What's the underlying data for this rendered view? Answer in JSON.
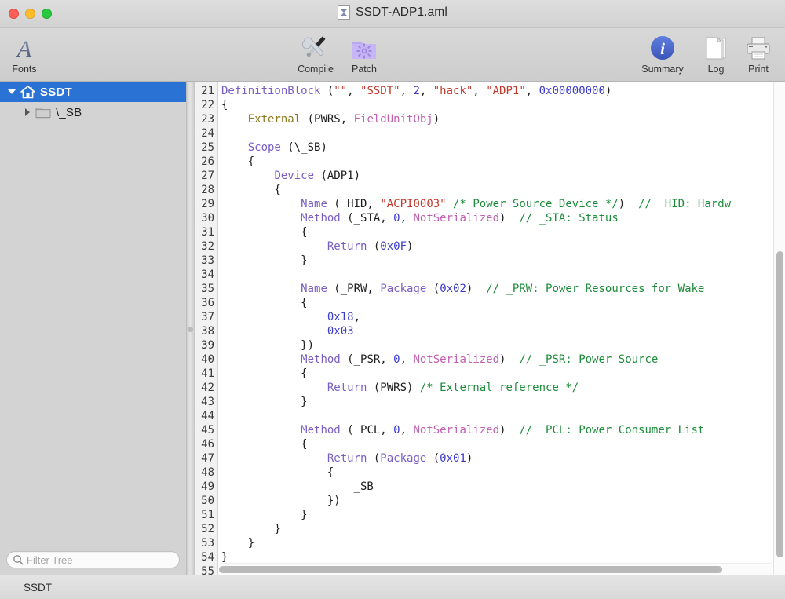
{
  "window": {
    "title": "SSDT-ADP1.aml",
    "doc_icon": "aml-document-icon",
    "traffic_lights": [
      "close-button",
      "minimize-button",
      "zoom-button"
    ]
  },
  "toolbar": {
    "items": [
      {
        "id": "fonts",
        "label": "Fonts",
        "icon": "fonts-icon"
      },
      {
        "id": "compile",
        "label": "Compile",
        "icon": "compile-tools-icon"
      },
      {
        "id": "patch",
        "label": "Patch",
        "icon": "patch-folder-icon"
      },
      {
        "id": "summary",
        "label": "Summary",
        "icon": "info-circle-icon"
      },
      {
        "id": "log",
        "label": "Log",
        "icon": "pages-stack-icon"
      },
      {
        "id": "print",
        "label": "Print",
        "icon": "printer-icon"
      }
    ]
  },
  "sidebar": {
    "tree": [
      {
        "label": "SSDT",
        "icon": "home-icon",
        "disclosure": "down",
        "selected": true,
        "depth": 0
      },
      {
        "label": "\\_SB",
        "icon": "folder-icon",
        "disclosure": "right",
        "selected": false,
        "depth": 1
      }
    ],
    "filter": {
      "placeholder": "Filter Tree",
      "value": "",
      "icon": "search-icon"
    }
  },
  "editor": {
    "first_line": 21,
    "last_line": 55,
    "lines": [
      {
        "n": 21,
        "tokens": [
          {
            "t": "kw",
            "v": "DefinitionBlock"
          },
          {
            "t": "pln",
            "v": " ("
          },
          {
            "t": "str",
            "v": "\"\""
          },
          {
            "t": "pln",
            "v": ", "
          },
          {
            "t": "str",
            "v": "\"SSDT\""
          },
          {
            "t": "pln",
            "v": ", "
          },
          {
            "t": "num",
            "v": "2"
          },
          {
            "t": "pln",
            "v": ", "
          },
          {
            "t": "str",
            "v": "\"hack\""
          },
          {
            "t": "pln",
            "v": ", "
          },
          {
            "t": "str",
            "v": "\"ADP1\""
          },
          {
            "t": "pln",
            "v": ", "
          },
          {
            "t": "num",
            "v": "0x00000000"
          },
          {
            "t": "pln",
            "v": ")"
          }
        ]
      },
      {
        "n": 22,
        "tokens": [
          {
            "t": "pln",
            "v": "{"
          }
        ]
      },
      {
        "n": 23,
        "tokens": [
          {
            "t": "pln",
            "v": "    "
          },
          {
            "t": "ext",
            "v": "External"
          },
          {
            "t": "pln",
            "v": " (PWRS, "
          },
          {
            "t": "typ",
            "v": "FieldUnitObj"
          },
          {
            "t": "pln",
            "v": ")"
          }
        ]
      },
      {
        "n": 24,
        "tokens": [
          {
            "t": "pln",
            "v": ""
          }
        ]
      },
      {
        "n": 25,
        "tokens": [
          {
            "t": "pln",
            "v": "    "
          },
          {
            "t": "kw",
            "v": "Scope"
          },
          {
            "t": "pln",
            "v": " (\\_SB)"
          }
        ]
      },
      {
        "n": 26,
        "tokens": [
          {
            "t": "pln",
            "v": "    {"
          }
        ]
      },
      {
        "n": 27,
        "tokens": [
          {
            "t": "pln",
            "v": "        "
          },
          {
            "t": "kw",
            "v": "Device"
          },
          {
            "t": "pln",
            "v": " (ADP1)"
          }
        ]
      },
      {
        "n": 28,
        "tokens": [
          {
            "t": "pln",
            "v": "        {"
          }
        ]
      },
      {
        "n": 29,
        "tokens": [
          {
            "t": "pln",
            "v": "            "
          },
          {
            "t": "kw",
            "v": "Name"
          },
          {
            "t": "pln",
            "v": " (_HID, "
          },
          {
            "t": "str",
            "v": "\"ACPI0003\""
          },
          {
            "t": "pln",
            "v": " "
          },
          {
            "t": "cmt",
            "v": "/* Power Source Device */"
          },
          {
            "t": "pln",
            "v": ")  "
          },
          {
            "t": "cmt",
            "v": "// _HID: Hardw"
          }
        ]
      },
      {
        "n": 30,
        "tokens": [
          {
            "t": "pln",
            "v": "            "
          },
          {
            "t": "kw",
            "v": "Method"
          },
          {
            "t": "pln",
            "v": " (_STA, "
          },
          {
            "t": "num",
            "v": "0"
          },
          {
            "t": "pln",
            "v": ", "
          },
          {
            "t": "typ",
            "v": "NotSerialized"
          },
          {
            "t": "pln",
            "v": ")  "
          },
          {
            "t": "cmt",
            "v": "// _STA: Status"
          }
        ]
      },
      {
        "n": 31,
        "tokens": [
          {
            "t": "pln",
            "v": "            {"
          }
        ]
      },
      {
        "n": 32,
        "tokens": [
          {
            "t": "pln",
            "v": "                "
          },
          {
            "t": "kw",
            "v": "Return"
          },
          {
            "t": "pln",
            "v": " ("
          },
          {
            "t": "num",
            "v": "0x0F"
          },
          {
            "t": "pln",
            "v": ")"
          }
        ]
      },
      {
        "n": 33,
        "tokens": [
          {
            "t": "pln",
            "v": "            }"
          }
        ]
      },
      {
        "n": 34,
        "tokens": [
          {
            "t": "pln",
            "v": ""
          }
        ]
      },
      {
        "n": 35,
        "tokens": [
          {
            "t": "pln",
            "v": "            "
          },
          {
            "t": "kw",
            "v": "Name"
          },
          {
            "t": "pln",
            "v": " (_PRW, "
          },
          {
            "t": "kw",
            "v": "Package"
          },
          {
            "t": "pln",
            "v": " ("
          },
          {
            "t": "num",
            "v": "0x02"
          },
          {
            "t": "pln",
            "v": ")  "
          },
          {
            "t": "cmt",
            "v": "// _PRW: Power Resources for Wake"
          }
        ]
      },
      {
        "n": 36,
        "tokens": [
          {
            "t": "pln",
            "v": "            {"
          }
        ]
      },
      {
        "n": 37,
        "tokens": [
          {
            "t": "pln",
            "v": "                "
          },
          {
            "t": "num",
            "v": "0x18"
          },
          {
            "t": "pln",
            "v": ","
          }
        ]
      },
      {
        "n": 38,
        "tokens": [
          {
            "t": "pln",
            "v": "                "
          },
          {
            "t": "num",
            "v": "0x03"
          }
        ]
      },
      {
        "n": 39,
        "tokens": [
          {
            "t": "pln",
            "v": "            })"
          }
        ]
      },
      {
        "n": 40,
        "tokens": [
          {
            "t": "pln",
            "v": "            "
          },
          {
            "t": "kw",
            "v": "Method"
          },
          {
            "t": "pln",
            "v": " (_PSR, "
          },
          {
            "t": "num",
            "v": "0"
          },
          {
            "t": "pln",
            "v": ", "
          },
          {
            "t": "typ",
            "v": "NotSerialized"
          },
          {
            "t": "pln",
            "v": ")  "
          },
          {
            "t": "cmt",
            "v": "// _PSR: Power Source"
          }
        ]
      },
      {
        "n": 41,
        "tokens": [
          {
            "t": "pln",
            "v": "            {"
          }
        ]
      },
      {
        "n": 42,
        "tokens": [
          {
            "t": "pln",
            "v": "                "
          },
          {
            "t": "kw",
            "v": "Return"
          },
          {
            "t": "pln",
            "v": " (PWRS) "
          },
          {
            "t": "cmt",
            "v": "/* External reference */"
          }
        ]
      },
      {
        "n": 43,
        "tokens": [
          {
            "t": "pln",
            "v": "            }"
          }
        ]
      },
      {
        "n": 44,
        "tokens": [
          {
            "t": "pln",
            "v": ""
          }
        ]
      },
      {
        "n": 45,
        "tokens": [
          {
            "t": "pln",
            "v": "            "
          },
          {
            "t": "kw",
            "v": "Method"
          },
          {
            "t": "pln",
            "v": " (_PCL, "
          },
          {
            "t": "num",
            "v": "0"
          },
          {
            "t": "pln",
            "v": ", "
          },
          {
            "t": "typ",
            "v": "NotSerialized"
          },
          {
            "t": "pln",
            "v": ")  "
          },
          {
            "t": "cmt",
            "v": "// _PCL: Power Consumer List"
          }
        ]
      },
      {
        "n": 46,
        "tokens": [
          {
            "t": "pln",
            "v": "            {"
          }
        ]
      },
      {
        "n": 47,
        "tokens": [
          {
            "t": "pln",
            "v": "                "
          },
          {
            "t": "kw",
            "v": "Return"
          },
          {
            "t": "pln",
            "v": " ("
          },
          {
            "t": "kw",
            "v": "Package"
          },
          {
            "t": "pln",
            "v": " ("
          },
          {
            "t": "num",
            "v": "0x01"
          },
          {
            "t": "pln",
            "v": ")"
          }
        ]
      },
      {
        "n": 48,
        "tokens": [
          {
            "t": "pln",
            "v": "                {"
          }
        ]
      },
      {
        "n": 49,
        "tokens": [
          {
            "t": "pln",
            "v": "                    _SB"
          }
        ]
      },
      {
        "n": 50,
        "tokens": [
          {
            "t": "pln",
            "v": "                })"
          }
        ]
      },
      {
        "n": 51,
        "tokens": [
          {
            "t": "pln",
            "v": "            }"
          }
        ]
      },
      {
        "n": 52,
        "tokens": [
          {
            "t": "pln",
            "v": "        }"
          }
        ]
      },
      {
        "n": 53,
        "tokens": [
          {
            "t": "pln",
            "v": "    }"
          }
        ]
      },
      {
        "n": 54,
        "tokens": [
          {
            "t": "pln",
            "v": "}"
          }
        ]
      },
      {
        "n": 55,
        "tokens": [
          {
            "t": "pln",
            "v": ""
          }
        ]
      }
    ],
    "colors": {
      "keyword": "#7a5ec4",
      "string": "#c0392b",
      "number": "#3b3bc9",
      "comment": "#1d8b3a",
      "type": "#c060b0",
      "external": "#8a7a20",
      "plain": "#1c1c1c",
      "background": "#ffffff",
      "gutter_background": "#f2f2f2"
    }
  },
  "statusbar": {
    "text": "SSDT"
  },
  "accents": {
    "selection_blue": "#2a72d4",
    "info_blue": "#4a6fd4",
    "patch_purple": "#b9a6f0"
  }
}
